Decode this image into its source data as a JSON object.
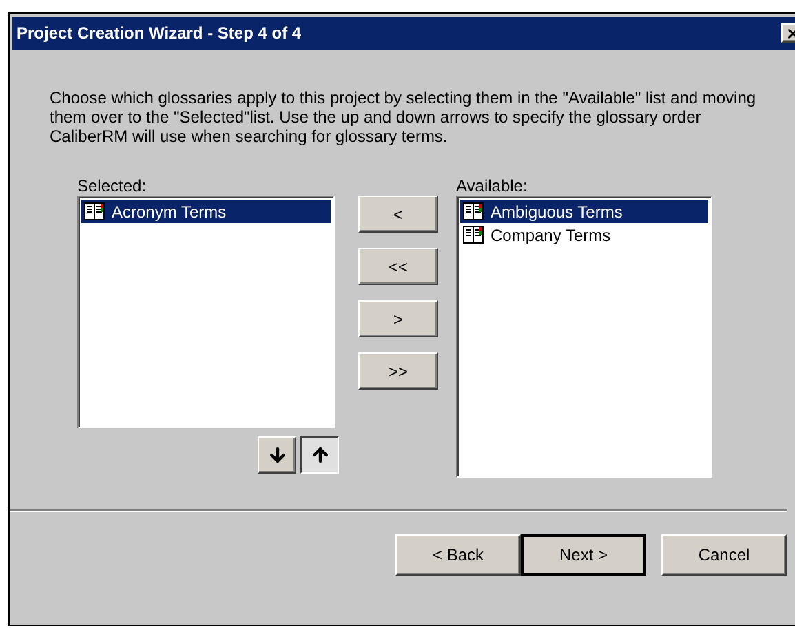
{
  "window": {
    "title": "Project Creation Wizard - Step 4 of 4"
  },
  "instructions": "Choose which glossaries apply to this project by selecting them in the \"Available\" list and moving them over to the \"Selected\"list.  Use the up and down arrows to specify the glossary order CaliberRM will use when searching for glossary terms.",
  "selected_list": {
    "label": "Selected:",
    "items": [
      {
        "name": "Acronym Terms",
        "selected": true
      }
    ]
  },
  "transfer_buttons": [
    "<",
    "<<",
    ">",
    ">>"
  ],
  "order_buttons": [
    {
      "kind": "down",
      "pressed": false
    },
    {
      "kind": "up",
      "pressed": true
    }
  ],
  "available_list": {
    "label": "Available:",
    "items": [
      {
        "name": "Ambiguous Terms",
        "selected": true
      },
      {
        "name": "Company Terms",
        "selected": false
      }
    ]
  },
  "buttons": [
    {
      "label": "< Back",
      "default": false
    },
    {
      "label": "Next >",
      "default": true
    },
    {
      "label": "Cancel",
      "default": false
    }
  ]
}
